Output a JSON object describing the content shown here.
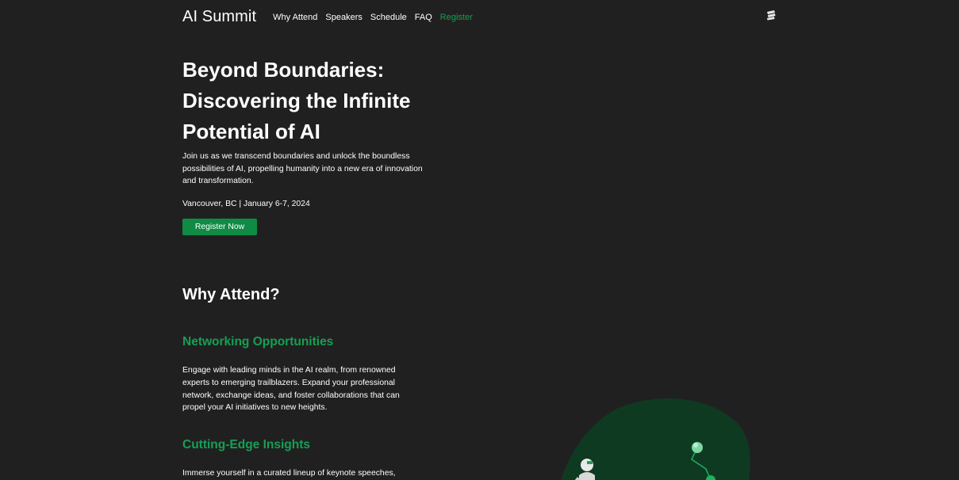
{
  "brand": {
    "title": "AI Summit",
    "accent_color": "#15a052"
  },
  "nav": {
    "items": [
      {
        "label": "Why Attend"
      },
      {
        "label": "Speakers"
      },
      {
        "label": "Schedule"
      },
      {
        "label": "FAQ"
      },
      {
        "label": "Register"
      }
    ],
    "theme_toggle_icon": "theme-toggle-icon"
  },
  "hero": {
    "title": "Beyond Boundaries: Discovering the Infinite Potential of AI",
    "description": "Join us as we transcend boundaries and unlock the boundless possibilities of AI, propelling humanity into a new era of innovation and transformation.",
    "meta": "Vancouver, BC | January 6-7, 2024",
    "cta_label": "Register Now",
    "cta_color": "#0f8b45"
  },
  "why_attend": {
    "title": "Why Attend?",
    "features": [
      {
        "title": "Networking Opportunities",
        "text": "Engage with leading minds in the AI realm, from renowned experts to emerging trailblazers. Expand your professional network, exchange ideas, and foster collaborations that can propel your AI initiatives to new heights."
      },
      {
        "title": "Cutting-Edge Insights",
        "text": "Immerse yourself in a curated lineup of keynote speeches,"
      }
    ]
  },
  "illustration": {
    "icon": "robot-illustration",
    "background_color": "#0f3a22"
  }
}
